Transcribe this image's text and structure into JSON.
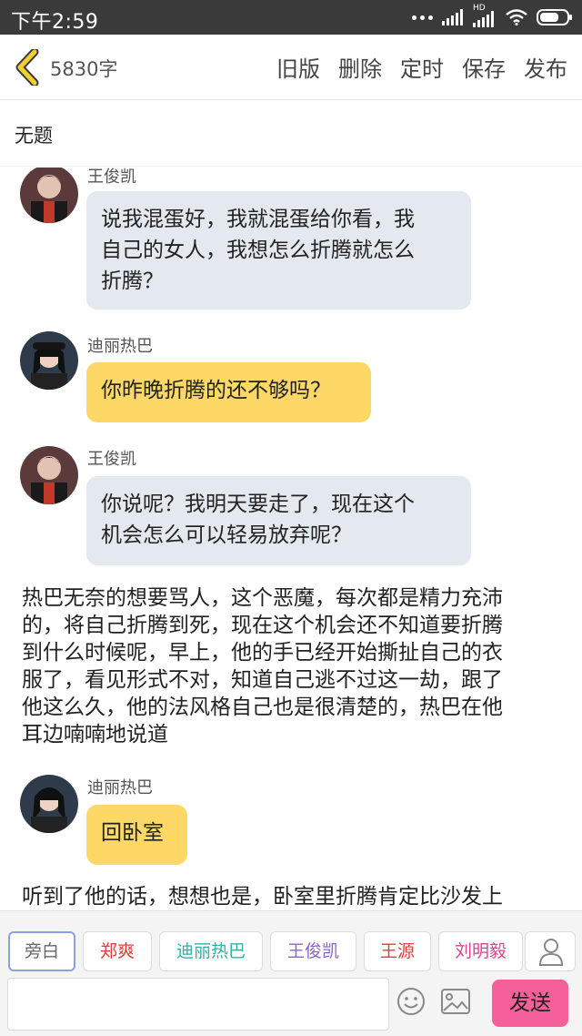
{
  "status_bar": {
    "time": "下午2:59",
    "network_label": "HD"
  },
  "header": {
    "word_count": "5830字",
    "actions": [
      "旧版",
      "删除",
      "定时",
      "保存",
      "发布"
    ]
  },
  "title": "无题",
  "chat": {
    "messages": [
      {
        "speaker": "王俊凯",
        "text": [
          "说我混蛋好，我就混蛋给你看，我",
          "自己的女人，我想怎么折腾就怎么",
          "折腾？"
        ]
      },
      {
        "speaker": "迪丽热巴",
        "text": [
          "你昨晚折腾的还不够吗？"
        ]
      },
      {
        "speaker": "王俊凯",
        "text": [
          "你说呢？我明天要走了，现在这个",
          "机会怎么可以轻易放弃呢？"
        ]
      },
      {
        "narration": [
          "热巴无奈的想要骂人，这个恶魔，每次都是精力充沛",
          "的，将自己折腾到死，现在这个机会还不知道要折腾",
          "到什么时候呢，早上，他的手已经开始撕扯自己的衣",
          "服了，看见形式不对，知道自己逃不过这一劫，跟了",
          "他这么久，他的法风格自己也是很清楚的，热巴在他",
          "耳边喃喃地说道"
        ]
      },
      {
        "speaker": "迪丽热巴",
        "text": [
          "回卧室"
        ]
      },
      {
        "narration": [
          "听到了他的话，想想也是，卧室里折腾肯定比沙发上"
        ]
      }
    ]
  },
  "characters": [
    {
      "name": "旁白",
      "color": "#777777"
    },
    {
      "name": "郑爽",
      "color": "#e0403a"
    },
    {
      "name": "迪丽热巴",
      "color": "#2bb3a8"
    },
    {
      "name": "王俊凯",
      "color": "#8b63c9"
    },
    {
      "name": "王源",
      "color": "#e0403a"
    },
    {
      "name": "刘明毅",
      "color": "#d8468f"
    }
  ],
  "composer": {
    "placeholder": "",
    "send_label": "发送"
  },
  "colors": {
    "accent_pink": "#f5609a",
    "bubble_blue": "#e4e9ef",
    "bubble_yellow": "#fdd866",
    "back_arrow": "#f2cf34"
  }
}
